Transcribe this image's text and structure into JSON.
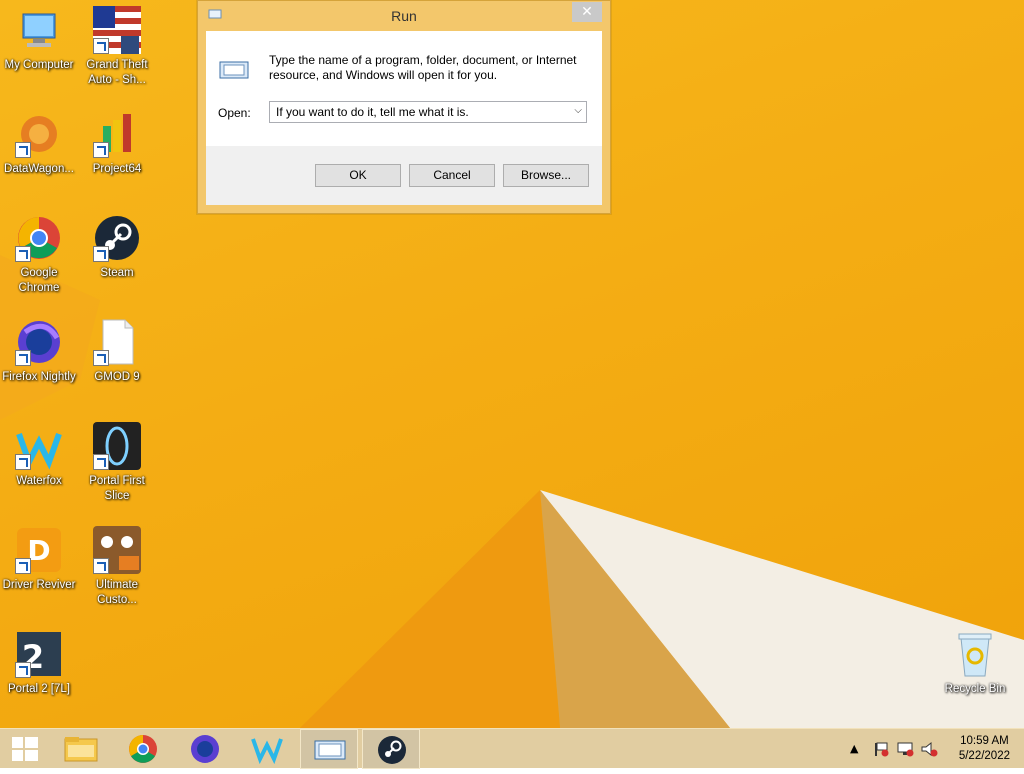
{
  "desktop_icons": [
    {
      "label": "My Computer"
    },
    {
      "label": "Grand Theft Auto - Sh..."
    },
    {
      "label": "DataWagon..."
    },
    {
      "label": "Project64"
    },
    {
      "label": "Google Chrome"
    },
    {
      "label": "Steam"
    },
    {
      "label": "Firefox Nightly"
    },
    {
      "label": "GMOD 9"
    },
    {
      "label": "Waterfox"
    },
    {
      "label": "Portal First Slice"
    },
    {
      "label": "Driver Reviver"
    },
    {
      "label": "Ultimate Custo..."
    },
    {
      "label": "Portal 2 [7L]"
    },
    {
      "label": "Recycle Bin"
    }
  ],
  "run_dialog": {
    "title": "Run",
    "close_glyph": "✕",
    "description": "Type the name of a program, folder, document, or Internet resource, and Windows will open it for you.",
    "open_label": "Open:",
    "open_value": "If you want to do it, tell me what it is.",
    "ok_label": "OK",
    "cancel_label": "Cancel",
    "browse_label": "Browse..."
  },
  "taskbar": {
    "pinned": [
      "start-button",
      "file-explorer-icon",
      "chrome-icon",
      "firefox-nightly-icon",
      "waterfox-icon",
      "run-icon",
      "steam-icon"
    ],
    "clock_time": "10:59 AM",
    "clock_date": "5/22/2022"
  },
  "colors": {
    "wallpaper": "#f4ad14",
    "taskbar": "#e1cda1"
  }
}
